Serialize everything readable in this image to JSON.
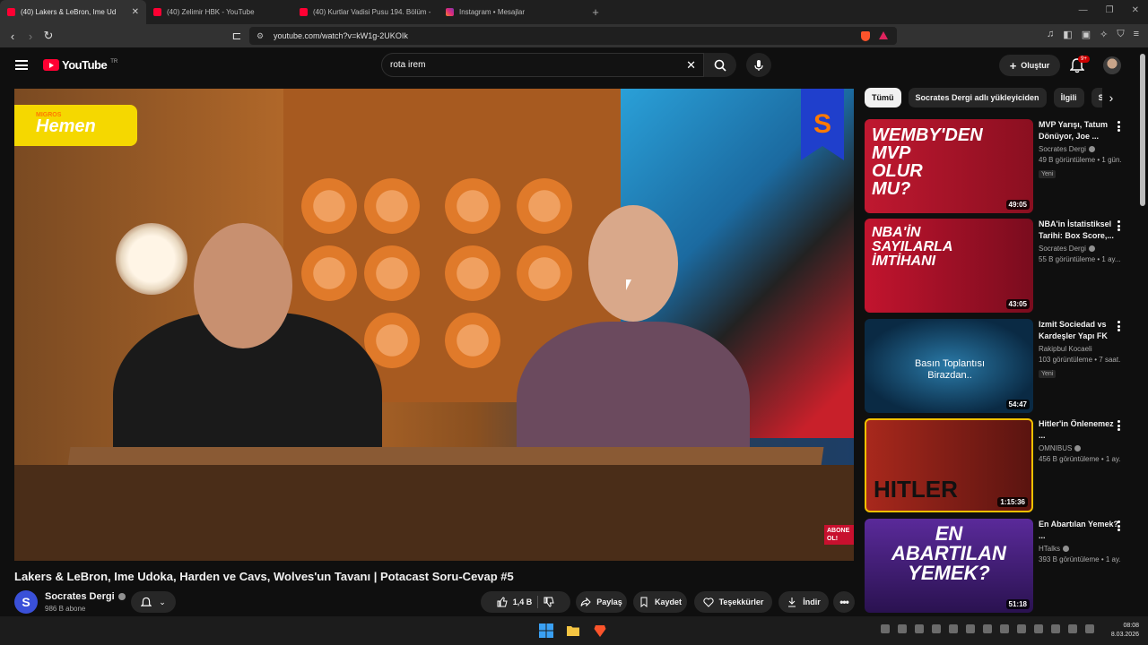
{
  "browser": {
    "tabs": [
      {
        "title": "(40) Lakers & LeBron, Ime Ud",
        "active": true
      },
      {
        "title": "(40) Zelimir HBK - YouTube",
        "active": false
      },
      {
        "title": "(40) Kurtlar Vadisi Pusu 194. Bölüm -",
        "active": false
      },
      {
        "title": "Instagram • Mesajlar",
        "active": false
      }
    ],
    "url": "youtube.com/watch?v=kW1g-2UKOIk"
  },
  "header": {
    "logo_text": "YouTube",
    "logo_region": "TR",
    "search_value": "rota irem",
    "create_label": "Oluştur",
    "notification_count": "9+"
  },
  "player": {
    "sponsor_top": "MIGROS",
    "sponsor_main": "Hemen",
    "brand_letter": "S",
    "subscribe_overlay": "ABONE OL!"
  },
  "video": {
    "title": "Lakers & LeBron, Ime Udoka, Harden ve Cavs, Wolves'un Tavanı | Potacast Soru-Cevap #5",
    "channel": "Socrates Dergi",
    "channel_initial": "S",
    "subscribers": "986 B abone",
    "likes": "1,4 B",
    "share_label": "Paylaş",
    "save_label": "Kaydet",
    "thanks_label": "Teşekkürler",
    "download_label": "İndir"
  },
  "chips": [
    "Tümü",
    "Socrates Dergi adlı yükleyiciden",
    "İlgili",
    "S"
  ],
  "recommendations": [
    {
      "title": "MVP Yarışı, Tatum Dönüyor, Joe ...",
      "channel": "Socrates Dergi",
      "verified": true,
      "meta": "49 B görüntüleme • 1 gün...",
      "new": "Yeni",
      "duration": "49:05",
      "thumb_text": "WEMBY'DEN MVP OLUR MU?",
      "thumb_bg": "#b8102a"
    },
    {
      "title": "NBA'in İstatistiksel Tarihi: Box Score,...",
      "channel": "Socrates Dergi",
      "verified": true,
      "meta": "55 B görüntüleme • 1 ay...",
      "new": "",
      "duration": "43:05",
      "thumb_text": "NBA'İN SAYILARLA İMTİHANI",
      "thumb_bg": "#b3122e"
    },
    {
      "title": "Izmit Sociedad vs Kardeşler Yapı FK",
      "channel": "Rakipbul Kocaeli",
      "verified": false,
      "meta": "103 görüntüleme • 7 saat...",
      "new": "Yeni",
      "duration": "54:47",
      "thumb_text": "Basın Toplantısı Birazdan..",
      "thumb_bg": "#0e3a5a"
    },
    {
      "title": "Hitler'in Önlenemez ...",
      "channel": "OMNIBUS",
      "verified": true,
      "meta": "456 B görüntüleme • 1 ay...",
      "new": "",
      "duration": "1:15:36",
      "thumb_text": "HITLER",
      "thumb_bg": "#8a1a14"
    },
    {
      "title": "En Abartılan Yemek? ...",
      "channel": "HTalks",
      "verified": true,
      "meta": "393 B görüntüleme • 1 ay...",
      "new": "",
      "duration": "51:18",
      "thumb_text": "EN ABARTILAN YEMEK?",
      "thumb_bg": "#4a2a7a"
    }
  ],
  "taskbar": {
    "time": "08:08",
    "date": "8.03.2026"
  }
}
